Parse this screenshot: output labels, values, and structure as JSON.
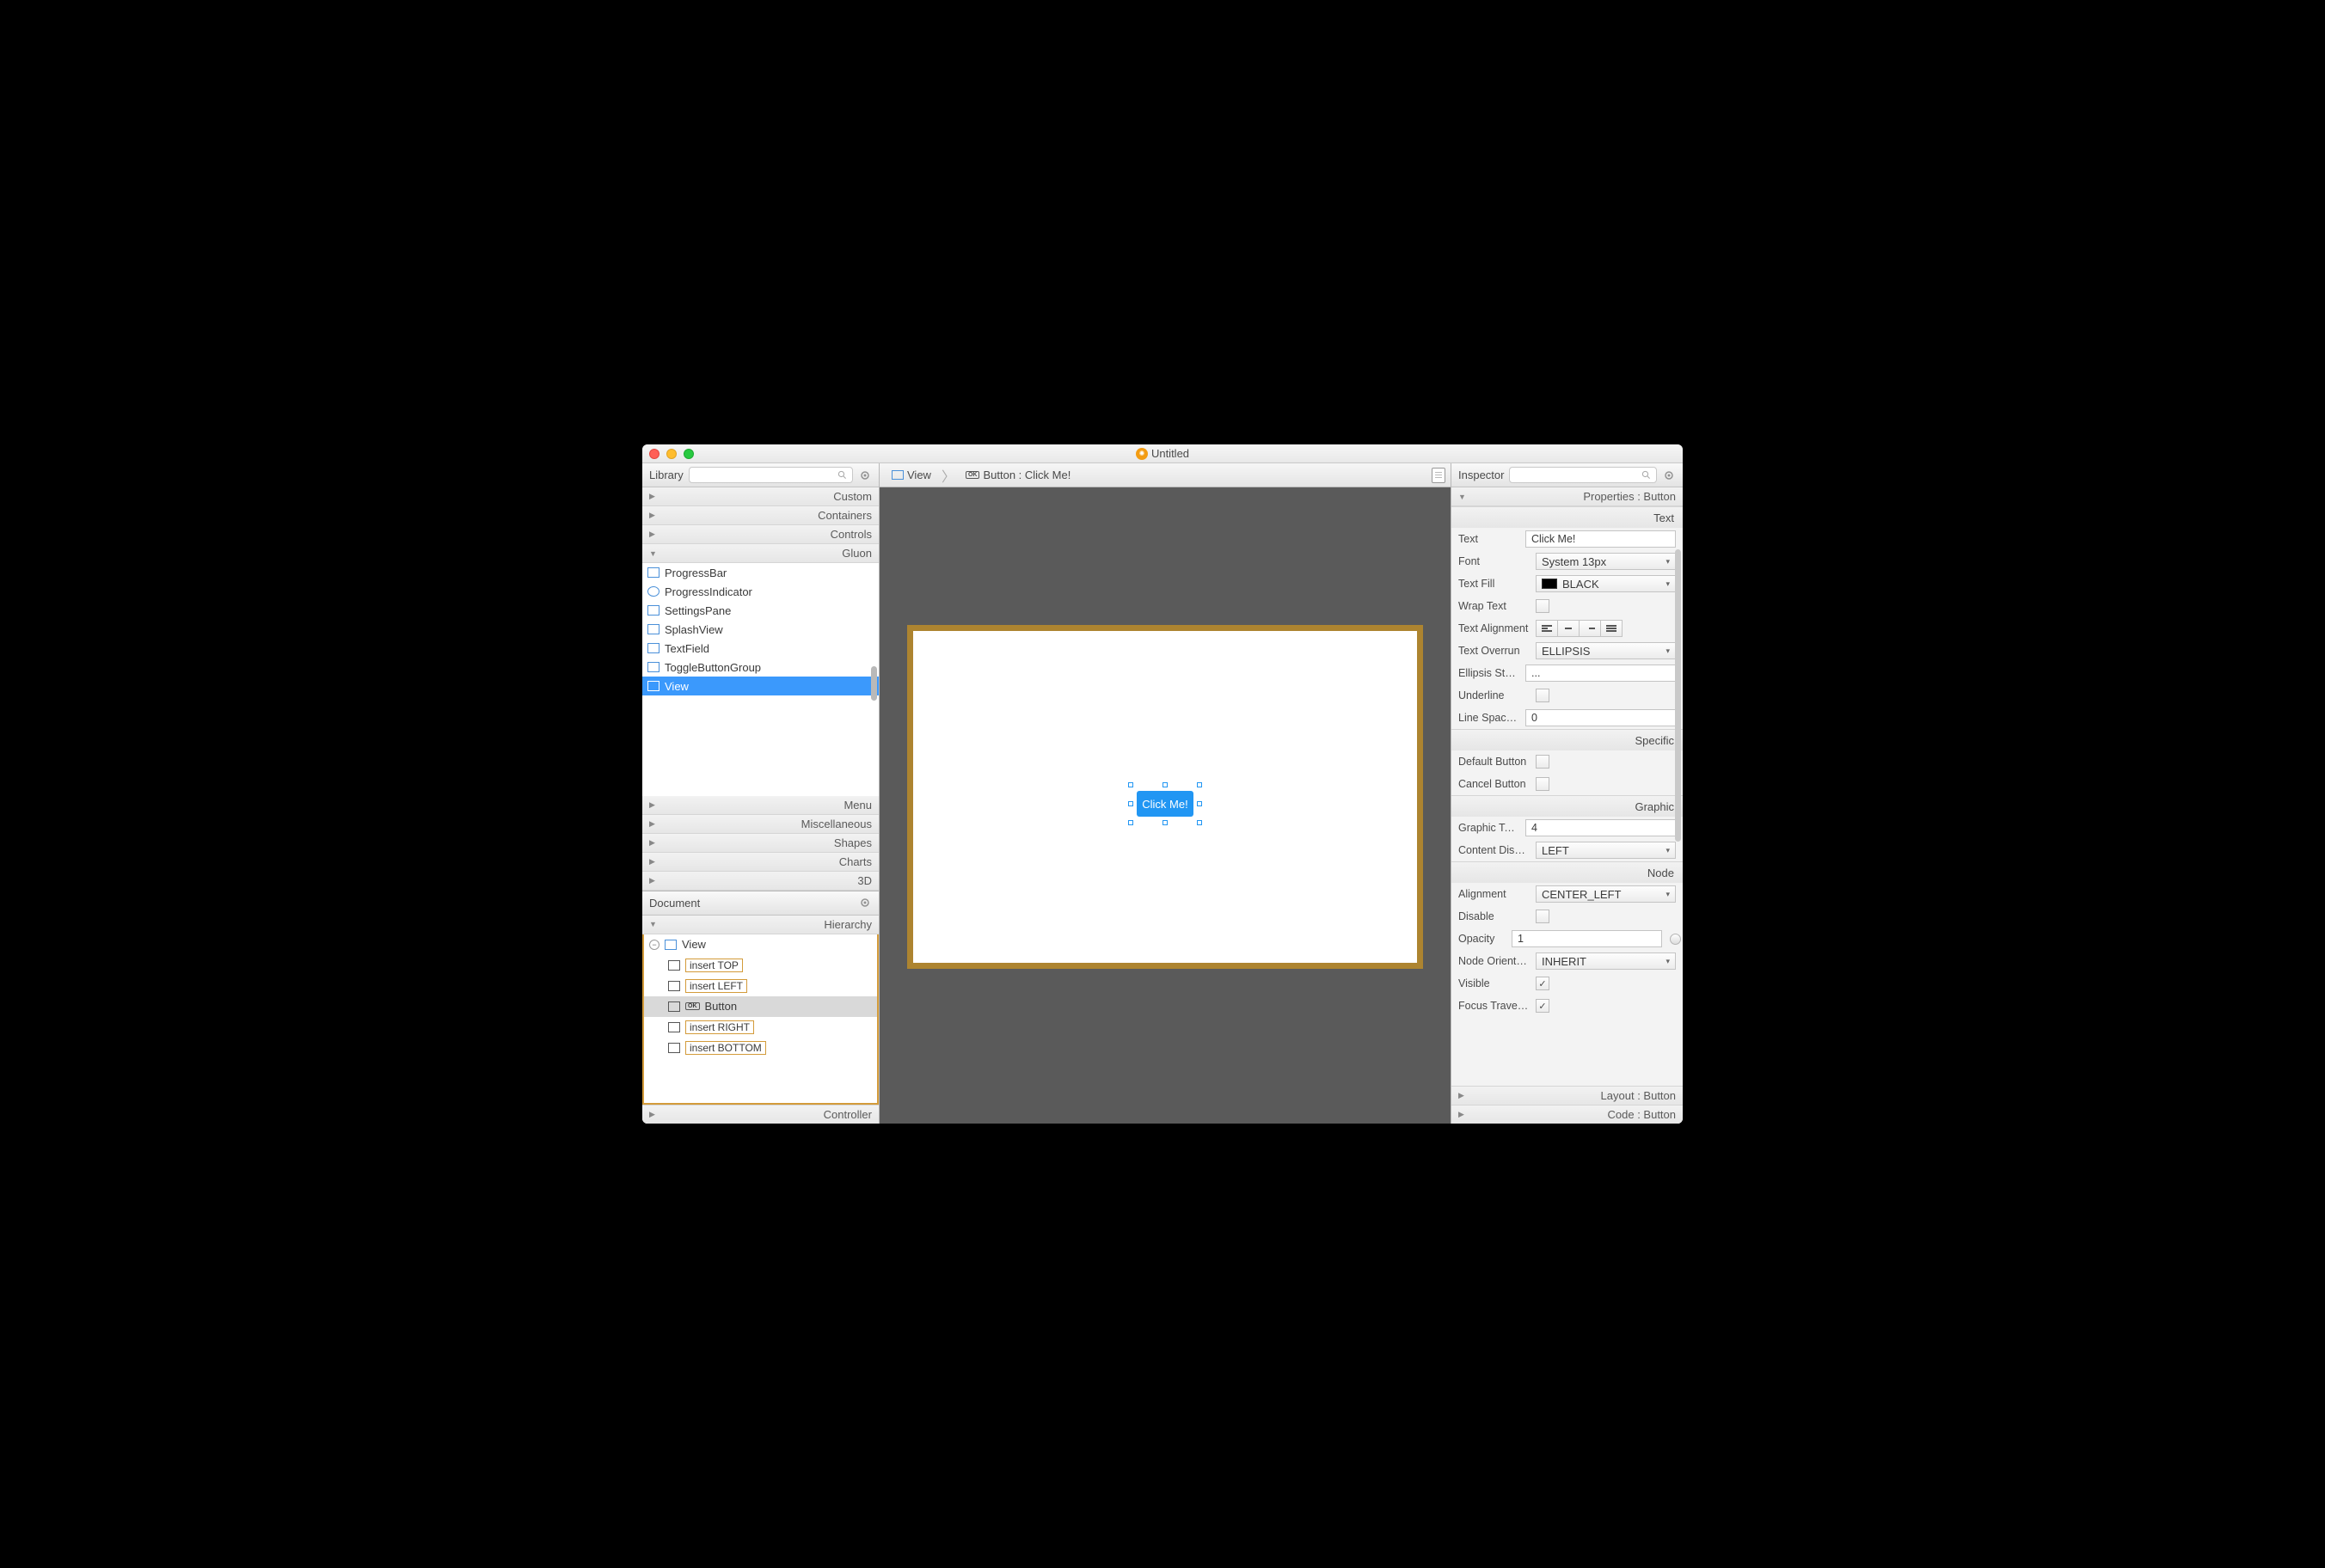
{
  "window": {
    "title": "Untitled"
  },
  "library": {
    "title": "Library",
    "categories": {
      "custom": "Custom",
      "containers": "Containers",
      "controls": "Controls",
      "gluon": "Gluon",
      "menu": "Menu",
      "miscellaneous": "Miscellaneous",
      "shapes": "Shapes",
      "charts": "Charts",
      "three_d": "3D"
    },
    "gluon_items": [
      "ProgressBar",
      "ProgressIndicator",
      "SettingsPane",
      "SplashView",
      "TextField",
      "ToggleButtonGroup",
      "View"
    ],
    "selected": "View"
  },
  "document": {
    "title": "Document",
    "hierarchy_label": "Hierarchy",
    "tree": {
      "root": "View",
      "children": [
        {
          "label": "insert TOP",
          "placeholder": true
        },
        {
          "label": "insert LEFT",
          "placeholder": true
        },
        {
          "label": "Button",
          "placeholder": false,
          "selected": true
        },
        {
          "label": "insert RIGHT",
          "placeholder": true
        },
        {
          "label": "insert BOTTOM",
          "placeholder": true
        }
      ]
    },
    "controller_label": "Controller"
  },
  "breadcrumb": {
    "seg1": "View",
    "seg2": "Button : Click Me!"
  },
  "canvas": {
    "button_text": "Click Me!"
  },
  "inspector": {
    "title": "Inspector",
    "properties_header": "Properties : Button",
    "layout_header": "Layout : Button",
    "code_header": "Code : Button",
    "sections": {
      "text": {
        "header": "Text",
        "labels": {
          "text": "Text",
          "font": "Font",
          "text_fill": "Text Fill",
          "wrap_text": "Wrap Text",
          "text_alignment": "Text Alignment",
          "text_overrun": "Text Overrun",
          "ellipsis_string": "Ellipsis String",
          "underline": "Underline",
          "line_spacing": "Line Spacing"
        },
        "values": {
          "text": "Click Me!",
          "font": "System 13px",
          "text_fill": "BLACK",
          "text_overrun": "ELLIPSIS",
          "ellipsis_string": "...",
          "line_spacing": "0"
        }
      },
      "specific": {
        "header": "Specific",
        "labels": {
          "default_button": "Default Button",
          "cancel_button": "Cancel Button"
        }
      },
      "graphic": {
        "header": "Graphic",
        "labels": {
          "graphic_text_gap": "Graphic Text ...",
          "content_display": "Content Display"
        },
        "values": {
          "graphic_text_gap": "4",
          "content_display": "LEFT"
        }
      },
      "node": {
        "header": "Node",
        "labels": {
          "alignment": "Alignment",
          "disable": "Disable",
          "opacity": "Opacity",
          "node_orientation": "Node Orienta...",
          "visible": "Visible",
          "focus_traversable": "Focus Traver..."
        },
        "values": {
          "alignment": "CENTER_LEFT",
          "opacity": "1",
          "node_orientation": "INHERIT"
        }
      }
    }
  }
}
